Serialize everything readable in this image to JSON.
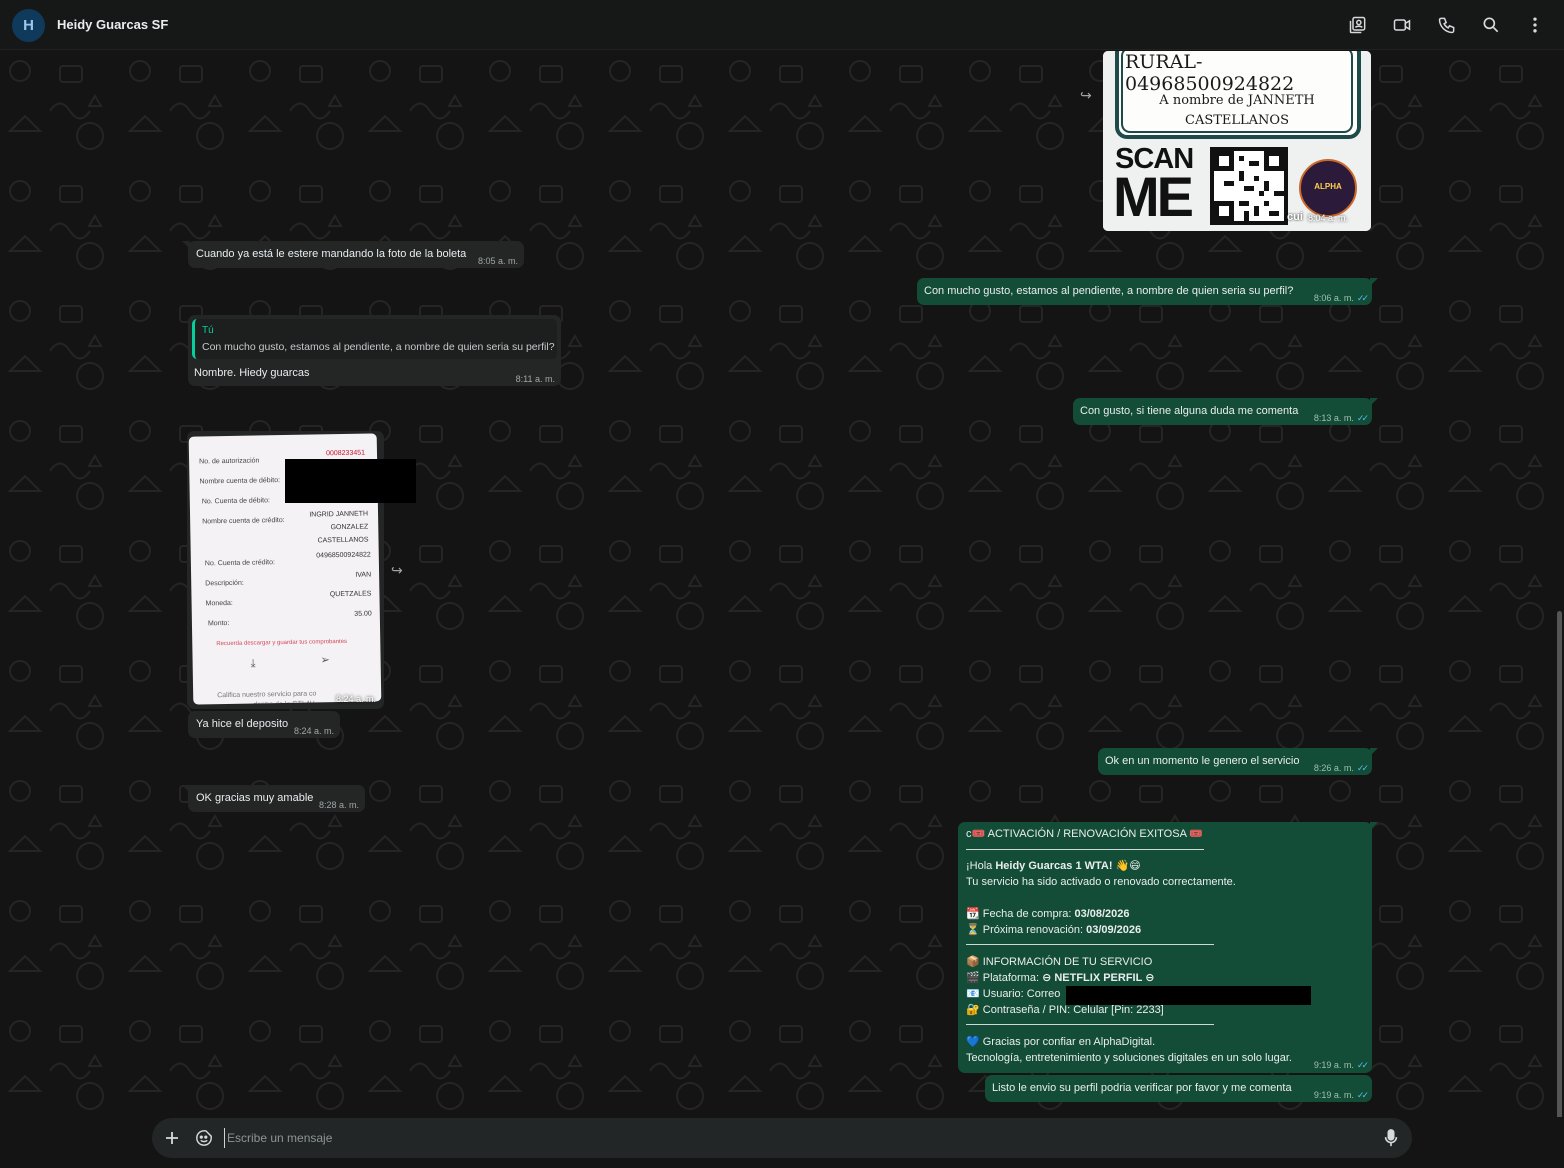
{
  "header": {
    "avatar_initial": "H",
    "contact_name": "Heidy Guarcas SF"
  },
  "messages": {
    "qr_card": {
      "line1": "RURAL-04968500924822",
      "line2": "A nombre de JANNETH",
      "line3": "CASTELLANOS",
      "scan": "SCAN",
      "me": "ME",
      "brand": "ALPHA",
      "cut_text": "cui",
      "time": "8:04 a. m."
    },
    "m1": {
      "text": "Cuando ya está le estere mandando la foto de la boleta",
      "time": "8:05 a. m."
    },
    "m2": {
      "text": "Con mucho gusto, estamos al pendiente, a nombre de quien seria su perfil?",
      "time": "8:06 a. m."
    },
    "m3": {
      "quote_author": "Tú",
      "quote_text": "Con mucho gusto, estamos al pendiente, a nombre de quien seria su perfil?",
      "text": "Nombre.  Hiedy guarcas",
      "time": "8:11 a. m."
    },
    "m4": {
      "text": "Con gusto, si tiene alguna duda me comenta",
      "time": "8:13 a. m."
    },
    "receipt": {
      "auth_label": "No. de autorización",
      "auth_value": "0008233451",
      "debit_name_label": "Nombre cuenta de débito:",
      "debit_no_label": "No. Cuenta de débito:",
      "credit_name_label": "Nombre cuenta de crédito:",
      "credit_name_1": "INGRID JANNETH",
      "credit_name_2": "GONZALEZ",
      "credit_name_3": "CASTELLANOS",
      "credit_no_label": "No. Cuenta de crédito:",
      "credit_no_value": "04968500924822",
      "desc_label": "Descripción:",
      "desc_value": "IVAN",
      "currency_label": "Moneda:",
      "currency_value": "QUETZALES",
      "amount_label": "Monto:",
      "amount_value": "35.00",
      "reminder": "Recuerda descargar y guardar tus comprobantes",
      "footer": "Califica nuestro servicio para co",
      "footer2": "dentro de la GTI 4H",
      "time": "8:24 a. m."
    },
    "m5": {
      "text": "Ya hice el deposito",
      "time": "8:24 a. m."
    },
    "m6": {
      "text": "Ok en un momento le genero el servicio",
      "time": "8:26 a. m."
    },
    "m7": {
      "text": "OK gracias muy amable",
      "time": "8:28 a. m."
    },
    "activation": {
      "title": "c🎟️ ACTIVACIÓN / RENOVACIÓN EXITOSA 🎟️",
      "greet_pre": "¡Hola ",
      "greet_name": "Heidy Guarcas 1 WTA!",
      "greet_emoji": " 👋😄",
      "line_activated": "Tu servicio ha sido activado o renovado correctamente.",
      "purchase_label": "📆 Fecha de compra: ",
      "purchase_date": "03/08/2026",
      "renewal_label": "⏳ Próxima renovación: ",
      "renewal_date": "03/09/2026",
      "info_title": "📦 INFORMACIÓN DE TU SERVICIO",
      "platform_label": "🎬 Plataforma: ",
      "platform_value": "⊖ NETFLIX PERFIL ⊖",
      "user_label": "📧 Usuario: Correo",
      "pass_label": "🔐 Contraseña / PIN: Celular [Pin: 2233]",
      "thanks": "💙 Gracias por confiar en AlphaDigital.",
      "tagline": "Tecnología, entretenimiento y soluciones digitales en un solo lugar.",
      "time": "9:19 a. m."
    },
    "m8": {
      "text": "Listo le envio su perfil podria verificar por favor y me comenta",
      "time": "9:19 a. m."
    }
  },
  "composer": {
    "placeholder": "Escribe un mensaje"
  },
  "colors": {
    "incoming": "#242626",
    "outgoing": "#144d37",
    "read_ticks": "#53bdeb",
    "accent": "#06cf9c"
  }
}
